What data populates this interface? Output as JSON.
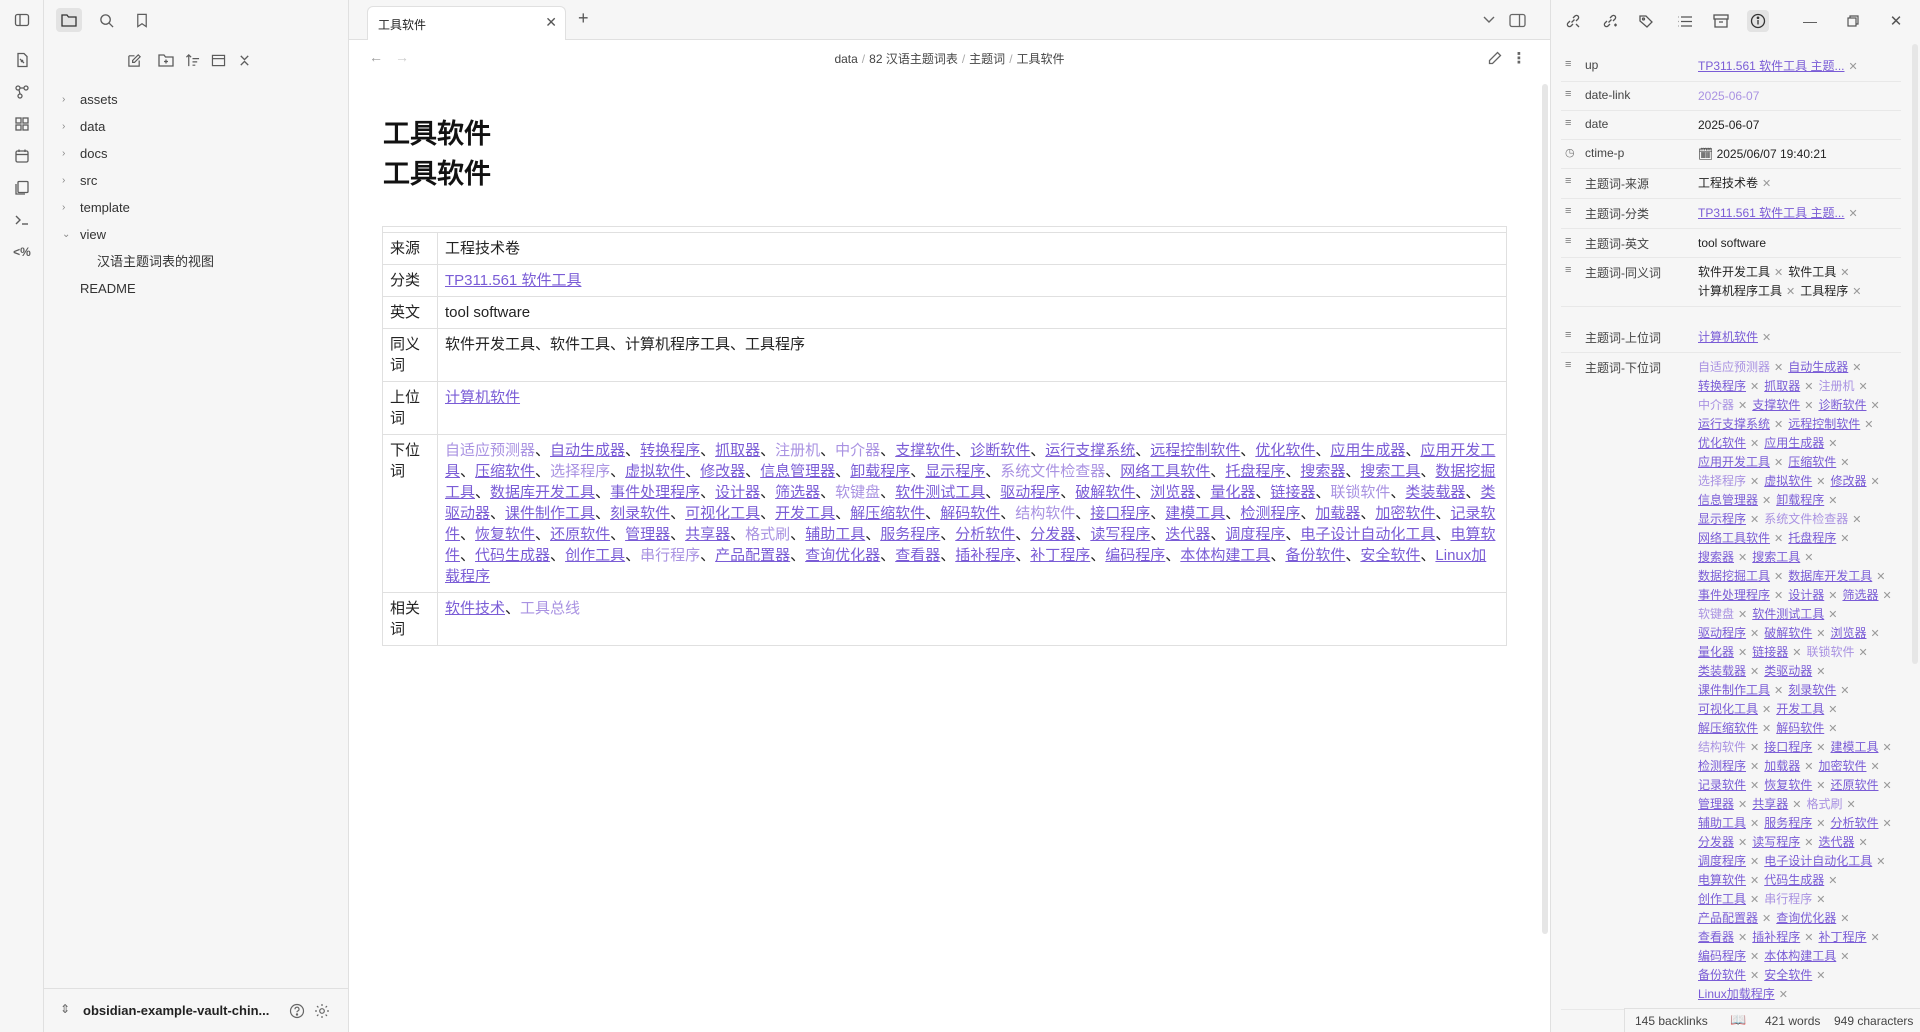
{
  "window": {
    "title": "工具软件"
  },
  "sidebar": {
    "tree": [
      {
        "label": "assets",
        "type": "folder"
      },
      {
        "label": "data",
        "type": "folder"
      },
      {
        "label": "docs",
        "type": "folder"
      },
      {
        "label": "src",
        "type": "folder"
      },
      {
        "label": "template",
        "type": "folder"
      },
      {
        "label": "view",
        "type": "folder-open"
      },
      {
        "label": "汉语主题词表的视图",
        "type": "child"
      },
      {
        "label": "README",
        "type": "file"
      }
    ],
    "vault_name": "obsidian-example-vault-chin..."
  },
  "tabs": [
    {
      "label": "工具软件"
    }
  ],
  "breadcrumb": [
    "data",
    "82 汉语主题词表",
    "主题词",
    "工具软件"
  ],
  "note": {
    "title1": "工具软件",
    "title2": "工具软件",
    "table": {
      "source_key": "来源",
      "source_val": "工程技术卷",
      "class_key": "分类",
      "class_val": "TP311.561 软件工具",
      "en_key": "英文",
      "en_val": "tool software",
      "syn_key": "同义词",
      "syn_val": "软件开发工具、软件工具、计算机程序工具、工具程序",
      "up_key": "上位词",
      "up_val": "计算机软件",
      "down_key": "下位词",
      "related_key": "相关词",
      "related": [
        {
          "t": "软件技术",
          "r": true
        },
        {
          "t": "工具总线",
          "r": false
        }
      ]
    },
    "narrower": [
      {
        "t": "自适应预测器",
        "r": false
      },
      {
        "t": "自动生成器",
        "r": true
      },
      {
        "t": "转换程序",
        "r": true
      },
      {
        "t": "抓取器",
        "r": true
      },
      {
        "t": "注册机",
        "r": false
      },
      {
        "t": "中介器",
        "r": false
      },
      {
        "t": "支撑软件",
        "r": true
      },
      {
        "t": "诊断软件",
        "r": true
      },
      {
        "t": "运行支撑系统",
        "r": true
      },
      {
        "t": "远程控制软件",
        "r": true
      },
      {
        "t": "优化软件",
        "r": true
      },
      {
        "t": "应用生成器",
        "r": true
      },
      {
        "t": "应用开发工具",
        "r": true
      },
      {
        "t": "压缩软件",
        "r": true
      },
      {
        "t": "选择程序",
        "r": false
      },
      {
        "t": "虚拟软件",
        "r": true
      },
      {
        "t": "修改器",
        "r": true
      },
      {
        "t": "信息管理器",
        "r": true
      },
      {
        "t": "卸载程序",
        "r": true
      },
      {
        "t": "显示程序",
        "r": true
      },
      {
        "t": "系统文件检查器",
        "r": false
      },
      {
        "t": "网络工具软件",
        "r": true
      },
      {
        "t": "托盘程序",
        "r": true
      },
      {
        "t": "搜索器",
        "r": true
      },
      {
        "t": "搜索工具",
        "r": true
      },
      {
        "t": "数据挖掘工具",
        "r": true
      },
      {
        "t": "数据库开发工具",
        "r": true
      },
      {
        "t": "事件处理程序",
        "r": true
      },
      {
        "t": "设计器",
        "r": true
      },
      {
        "t": "筛选器",
        "r": true
      },
      {
        "t": "软键盘",
        "r": false
      },
      {
        "t": "软件测试工具",
        "r": true
      },
      {
        "t": "驱动程序",
        "r": true
      },
      {
        "t": "破解软件",
        "r": true
      },
      {
        "t": "浏览器",
        "r": true
      },
      {
        "t": "量化器",
        "r": true
      },
      {
        "t": "链接器",
        "r": true
      },
      {
        "t": "联锁软件",
        "r": false
      },
      {
        "t": "类装载器",
        "r": true
      },
      {
        "t": "类驱动器",
        "r": true
      },
      {
        "t": "课件制作工具",
        "r": true
      },
      {
        "t": "刻录软件",
        "r": true
      },
      {
        "t": "可视化工具",
        "r": true
      },
      {
        "t": "开发工具",
        "r": true
      },
      {
        "t": "解压缩软件",
        "r": true
      },
      {
        "t": "解码软件",
        "r": true
      },
      {
        "t": "结构软件",
        "r": false
      },
      {
        "t": "接口程序",
        "r": true
      },
      {
        "t": "建模工具",
        "r": true
      },
      {
        "t": "检测程序",
        "r": true
      },
      {
        "t": "加载器",
        "r": true
      },
      {
        "t": "加密软件",
        "r": true
      },
      {
        "t": "记录软件",
        "r": true
      },
      {
        "t": "恢复软件",
        "r": true
      },
      {
        "t": "还原软件",
        "r": true
      },
      {
        "t": "管理器",
        "r": true
      },
      {
        "t": "共享器",
        "r": true
      },
      {
        "t": "格式刷",
        "r": false
      },
      {
        "t": "辅助工具",
        "r": true
      },
      {
        "t": "服务程序",
        "r": true
      },
      {
        "t": "分析软件",
        "r": true
      },
      {
        "t": "分发器",
        "r": true
      },
      {
        "t": "读写程序",
        "r": true
      },
      {
        "t": "迭代器",
        "r": true
      },
      {
        "t": "调度程序",
        "r": true
      },
      {
        "t": "电子设计自动化工具",
        "r": true
      },
      {
        "t": "电算软件",
        "r": true
      },
      {
        "t": "代码生成器",
        "r": true
      },
      {
        "t": "创作工具",
        "r": true
      },
      {
        "t": "串行程序",
        "r": false
      },
      {
        "t": "产品配置器",
        "r": true
      },
      {
        "t": "查询优化器",
        "r": true
      },
      {
        "t": "查看器",
        "r": true
      },
      {
        "t": "插补程序",
        "r": true
      },
      {
        "t": "补丁程序",
        "r": true
      },
      {
        "t": "编码程序",
        "r": true
      },
      {
        "t": "本体构建工具",
        "r": true
      },
      {
        "t": "备份软件",
        "r": true
      },
      {
        "t": "安全软件",
        "r": true
      },
      {
        "t": "Linux加载程序",
        "r": true
      }
    ]
  },
  "properties": [
    {
      "icon": "≡",
      "key": "up",
      "values": [
        {
          "t": "TP311.561 软件工具 主题...",
          "c": "link"
        }
      ]
    },
    {
      "icon": "≡",
      "key": "date-link",
      "values": [
        {
          "t": "2025-06-07",
          "c": "unres",
          "nox": true
        }
      ]
    },
    {
      "icon": "≡",
      "key": "date",
      "values": [
        {
          "t": "2025-06-07",
          "c": "plain",
          "nox": true
        }
      ]
    },
    {
      "icon": "◷",
      "key": "ctime-p",
      "values": [
        {
          "t": "🗓  2025/06/07  19:40:21",
          "c": "plain",
          "nox": true
        }
      ]
    },
    {
      "icon": "≡",
      "key": "主题词-来源",
      "values": [
        {
          "t": "工程技术卷",
          "c": "plain"
        }
      ]
    },
    {
      "icon": "≡",
      "key": "主题词-分类",
      "values": [
        {
          "t": "TP311.561 软件工具 主题...",
          "c": "link"
        }
      ]
    },
    {
      "icon": "≡",
      "key": "主题词-英文",
      "values": [
        {
          "t": "tool software",
          "c": "plain",
          "nox": true
        }
      ]
    },
    {
      "icon": "≡",
      "key": "主题词-同义词",
      "values": [
        {
          "t": "软件开发工具",
          "c": "plain"
        },
        {
          "t": "软件工具",
          "c": "plain"
        },
        {
          "t": "计算机程序工具",
          "c": "plain"
        },
        {
          "t": "工具程序",
          "c": "plain"
        }
      ]
    },
    {
      "icon": "≡",
      "key": "主题词-上位词",
      "values": [
        {
          "t": "计算机软件",
          "c": "link"
        }
      ]
    },
    {
      "icon": "≡",
      "key": "主题词-下位词",
      "values": "narrower_ref"
    }
  ],
  "status": {
    "backlinks": "145 backlinks",
    "words": "421 words",
    "chars": "949 characters"
  }
}
